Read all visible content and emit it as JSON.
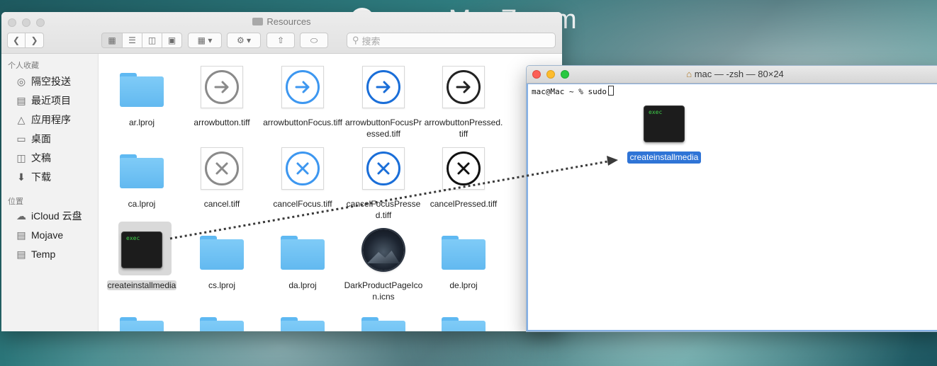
{
  "watermark": {
    "logo_letter": "Z",
    "text": "www.MacZ.com"
  },
  "finder": {
    "title": "Resources",
    "search_placeholder": "搜索",
    "sidebar": {
      "favorites_header": "个人收藏",
      "favorites": [
        {
          "label": "隔空投送",
          "icon": "airdrop-icon"
        },
        {
          "label": "最近项目",
          "icon": "recents-icon"
        },
        {
          "label": "应用程序",
          "icon": "applications-icon"
        },
        {
          "label": "桌面",
          "icon": "desktop-icon"
        },
        {
          "label": "文稿",
          "icon": "documents-icon"
        },
        {
          "label": "下载",
          "icon": "downloads-icon"
        }
      ],
      "locations_header": "位置",
      "locations": [
        {
          "label": "iCloud 云盘",
          "icon": "icloud-icon"
        },
        {
          "label": "Mojave",
          "icon": "disk-icon"
        },
        {
          "label": "Temp",
          "icon": "disk-icon"
        }
      ]
    },
    "files": [
      {
        "name": "ar.lproj",
        "kind": "folder"
      },
      {
        "name": "arrowbutton.tiff",
        "kind": "arrow-gray"
      },
      {
        "name": "arrowbuttonFocus.tiff",
        "kind": "arrow-blue-light"
      },
      {
        "name": "arrowbuttonFocusPressed.tiff",
        "kind": "arrow-blue-dark"
      },
      {
        "name": "arrowbuttonPressed.tiff",
        "kind": "arrow-black"
      },
      {
        "name": "ca.lproj",
        "kind": "folder"
      },
      {
        "name": "cancel.tiff",
        "kind": "cancel-gray"
      },
      {
        "name": "cancelFocus.tiff",
        "kind": "cancel-blue-light"
      },
      {
        "name": "cancelFocusPressed.tiff",
        "kind": "cancel-blue-dark"
      },
      {
        "name": "cancelPressed.tiff",
        "kind": "cancel-black"
      },
      {
        "name": "createinstallmedia",
        "kind": "exec",
        "selected": true
      },
      {
        "name": "cs.lproj",
        "kind": "folder"
      },
      {
        "name": "da.lproj",
        "kind": "folder"
      },
      {
        "name": "DarkProductPageIcon.icns",
        "kind": "icns"
      },
      {
        "name": "de.lproj",
        "kind": "folder"
      }
    ],
    "exec_icon_text": "exec"
  },
  "terminal": {
    "title": "mac — -zsh — 80×24",
    "prompt": "mac@Mac ~ % sudo",
    "drag_item_label": "createinstallmedia",
    "exec_icon_text": "exec"
  },
  "colors": {
    "selection_blue": "#2f74d6",
    "terminal_green": "#3fd14a",
    "folder_blue": "#6cc0f4"
  }
}
